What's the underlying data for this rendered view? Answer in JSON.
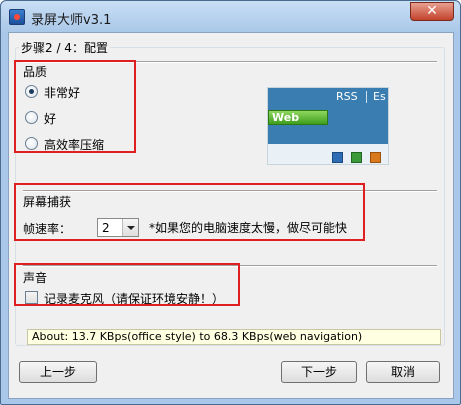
{
  "window": {
    "title": "录屏大师v3.1",
    "close_label": "✕"
  },
  "step_label": "步骤2 / 4：配置",
  "quality": {
    "heading": "品质",
    "options": [
      {
        "label": "非常好",
        "selected": true
      },
      {
        "label": "好",
        "selected": false
      },
      {
        "label": "高效率压缩",
        "selected": false
      }
    ],
    "preview": {
      "rss": "RSS",
      "es": "Es",
      "web": "Web",
      "swatches": [
        "#2e6db4",
        "#3a9a3a",
        "#d87a1c"
      ]
    }
  },
  "capture": {
    "heading": "屏幕捕获",
    "fps_label": "帧速率：",
    "fps_value": "2",
    "hint": "*如果您的电脑速度太慢，做尽可能快"
  },
  "audio": {
    "heading": "声音",
    "mic_label": "记录麦克风（请保证环境安静！）",
    "mic_checked": false
  },
  "info": "About: 13.7 KBps(office style) to 68.3 KBps(web navigation)",
  "buttons": {
    "prev": "上一步",
    "next": "下一步",
    "cancel": "取消"
  }
}
